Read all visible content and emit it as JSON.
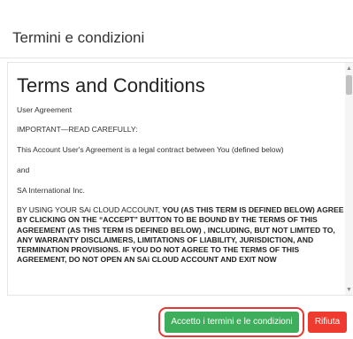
{
  "dialog": {
    "title": "Termini e condizioni"
  },
  "terms": {
    "heading": "Terms and Conditions",
    "user_agreement": "User Agreement",
    "important": "IMPORTANT—READ CAREFULLY:",
    "legal_contract": "This Account User's Agreement is a legal contract between You (defined below)",
    "and": "and",
    "company": "SA International Inc.",
    "intro": "BY USING YOUR SAi CLOUD ACCOUNT, ",
    "body": "YOU (AS THIS TERM IS DEFINED BELOW) AGREE BY CLICKING ON THE “ACCEPT” BUTTON TO BE BOUND BY THE TERMS OF THIS AGREEMENT (AS THIS TERM IS DEFINED BELOW) , INCLUDING, BUT NOT LIMITED TO, ANY WARRANTY DISCLAIMERS, LIMITATIONS OF LIABILITY, JURISDICTION, AND TERMINATION PROVISIONS. IF YOU DO NOT AGREE TO THE TERMS OF THIS AGREEMENT, DO NOT OPEN AN SAi CLOUD ACCOUNT AND EXIT NOW"
  },
  "footer": {
    "accept_label": "Accetto i termini e le condizioni",
    "decline_label": "Rifiuta"
  },
  "icons": {
    "scroll_up": "scroll-up-arrow-icon",
    "scroll_down": "scroll-down-arrow-icon"
  },
  "colors": {
    "accept_button": "#3fae5c",
    "decline_button": "#ee3a2f",
    "highlight_outline": "#e53935"
  }
}
